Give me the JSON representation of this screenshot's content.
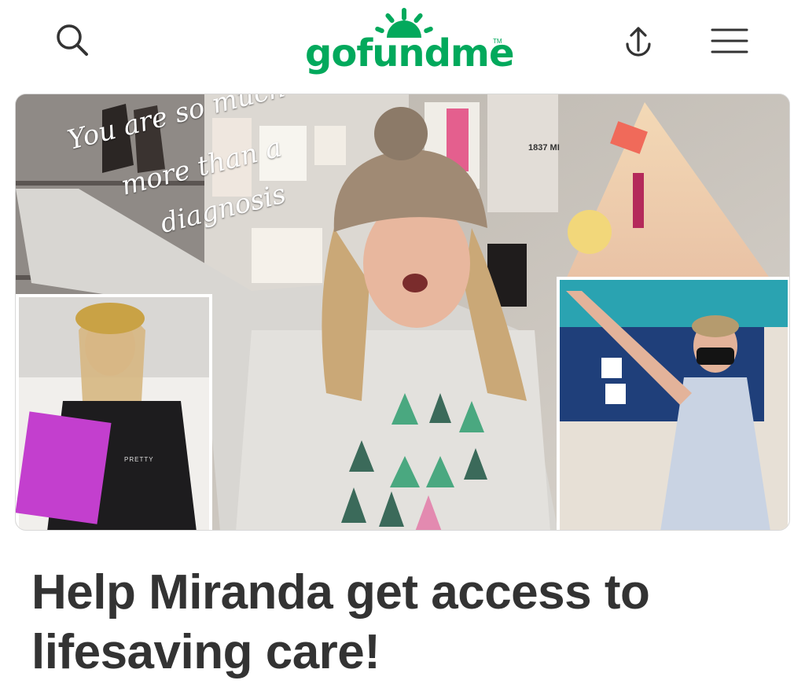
{
  "header": {
    "logo_text": "gofundme",
    "logo_tm": "TM",
    "brand_color": "#02a95c",
    "icons": {
      "search": "search-icon",
      "share": "share-icon",
      "menu": "menu-icon"
    }
  },
  "hero": {
    "overlay_lines": [
      "You are so much",
      "more than a",
      "diagnosis"
    ],
    "sign_text": "1837 MI",
    "shirt_text": "PRETTY"
  },
  "campaign": {
    "title": "Help Miranda get access to lifesaving care!"
  }
}
